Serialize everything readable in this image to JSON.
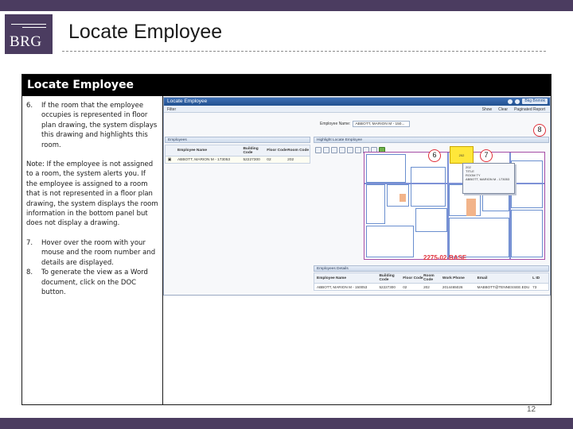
{
  "slide": {
    "logo_text": "BRG",
    "title": "Locate Employee",
    "frame_heading": "Locate Employee",
    "page_number": "12",
    "colors": {
      "bar": "#4b3c60",
      "marker": "#e0303a",
      "highlight": "#ffe73a"
    }
  },
  "instructions": {
    "step6_num": "6.",
    "step6_text": "If the room that the employee occupies is represented in floor plan drawing, the system displays this drawing and highlights this room.",
    "note": "Note: If the employee is not assigned to a room, the system alerts you. If the employee is assigned to a room that is not represented in a floor plan drawing, the system displays the room information in the bottom panel but does not display a drawing.",
    "step7_num": "7.",
    "step7_text": "Hover over the room with your mouse and the room number and details are displayed.",
    "step8_num": "8.",
    "step8_text": "To generate the view as a Word document, click on the DOC button."
  },
  "app": {
    "window_title": "Locate Employee",
    "help_label": "Bkg Bnmnk",
    "filter_label": "Filter",
    "show_label": "Show",
    "clear_label": "Clear",
    "paginated_report_label": "Paginated Report",
    "employee_name_label": "Employee Name:",
    "employee_name_value": "ABBOTT, MARION M - 150...",
    "employees_panel_title": "Employees",
    "highlight_panel_title": "Highlight Locate Employee",
    "employees_table": {
      "headers": [
        "Employee Name",
        "Building Code",
        "Floor Code",
        "Room Code"
      ],
      "rows": [
        {
          "name": "ABBOTT, MARION M - 173053",
          "building": "52227300",
          "floor": "02",
          "room": "202"
        }
      ]
    },
    "tooltip_lines": [
      "202",
      "TITLE",
      "ROOM TY",
      "ABBOTT, MARION M - 173053"
    ],
    "highlight_room_label": "202",
    "drawing_label": "2275-02-BASE",
    "details_panel_title": "Employees Details",
    "details_table": {
      "headers": [
        "Employee Name",
        "Building Code",
        "Floor Code",
        "Room Code",
        "Work Phone",
        "Email",
        "L ID"
      ],
      "rows": [
        {
          "name": "ABBOTT, MARION M - 150053",
          "building": "52227300",
          "floor": "02",
          "room": "202",
          "phone": "2014465026",
          "email": "MABBOTT@TENNESSEE.EDU",
          "id": "73"
        }
      ]
    },
    "markers": [
      "6",
      "7",
      "8"
    ]
  }
}
